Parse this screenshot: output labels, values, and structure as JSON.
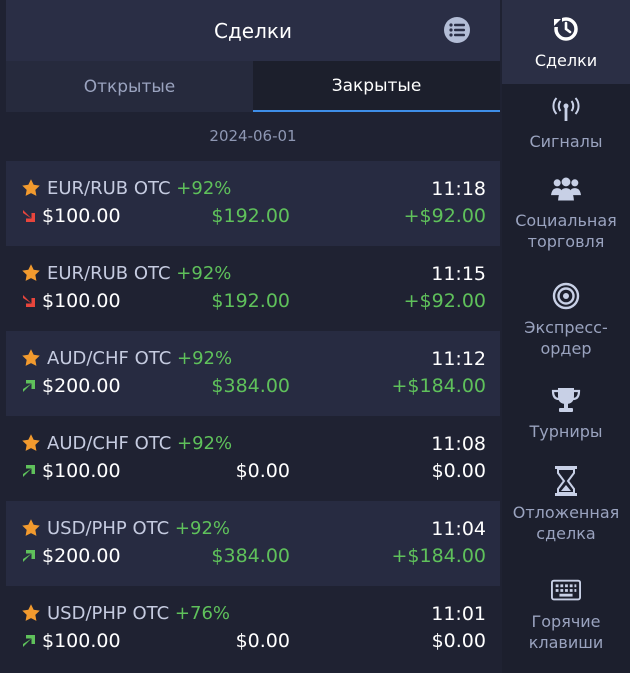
{
  "header": {
    "title": "Сделки"
  },
  "tabs": [
    {
      "label": "Открытые"
    },
    {
      "label": "Закрытые"
    }
  ],
  "date": "2024-06-01",
  "deals": [
    {
      "asset": "EUR/RUB OTC",
      "pct": "+92%",
      "time": "11:18",
      "direction": "down",
      "amount": "$100.00",
      "payout": "$192.00",
      "profit": "+$92.00"
    },
    {
      "asset": "EUR/RUB OTC",
      "pct": "+92%",
      "time": "11:15",
      "direction": "down",
      "amount": "$100.00",
      "payout": "$192.00",
      "profit": "+$92.00"
    },
    {
      "asset": "AUD/CHF OTC",
      "pct": "+92%",
      "time": "11:12",
      "direction": "up",
      "amount": "$200.00",
      "payout": "$384.00",
      "profit": "+$184.00"
    },
    {
      "asset": "AUD/CHF OTC",
      "pct": "+92%",
      "time": "11:08",
      "direction": "up",
      "amount": "$100.00",
      "payout": "$0.00",
      "profit": "$0.00"
    },
    {
      "asset": "USD/PHP OTC",
      "pct": "+92%",
      "time": "11:04",
      "direction": "up",
      "amount": "$200.00",
      "payout": "$384.00",
      "profit": "+$184.00"
    },
    {
      "asset": "USD/PHP OTC",
      "pct": "+76%",
      "time": "11:01",
      "direction": "up",
      "amount": "$100.00",
      "payout": "$0.00",
      "profit": "$0.00"
    }
  ],
  "sidebar": {
    "items": [
      {
        "label": "Сделки",
        "icon": "history-icon"
      },
      {
        "label": "Сигналы",
        "icon": "signal-icon"
      },
      {
        "label": "Социальная торговля",
        "icon": "users-icon"
      },
      {
        "label": "Экспресс-ордер",
        "icon": "target-icon"
      },
      {
        "label": "Турниры",
        "icon": "trophy-icon"
      },
      {
        "label": "Отложенная сделка",
        "icon": "hourglass-icon"
      },
      {
        "label": "Горячие клавиши",
        "icon": "keyboard-icon"
      }
    ]
  },
  "colors": {
    "accent": "#3e8ee8",
    "profit_green": "#5fc15b",
    "loss_red": "#e8453c",
    "star_orange": "#f29a2e"
  }
}
